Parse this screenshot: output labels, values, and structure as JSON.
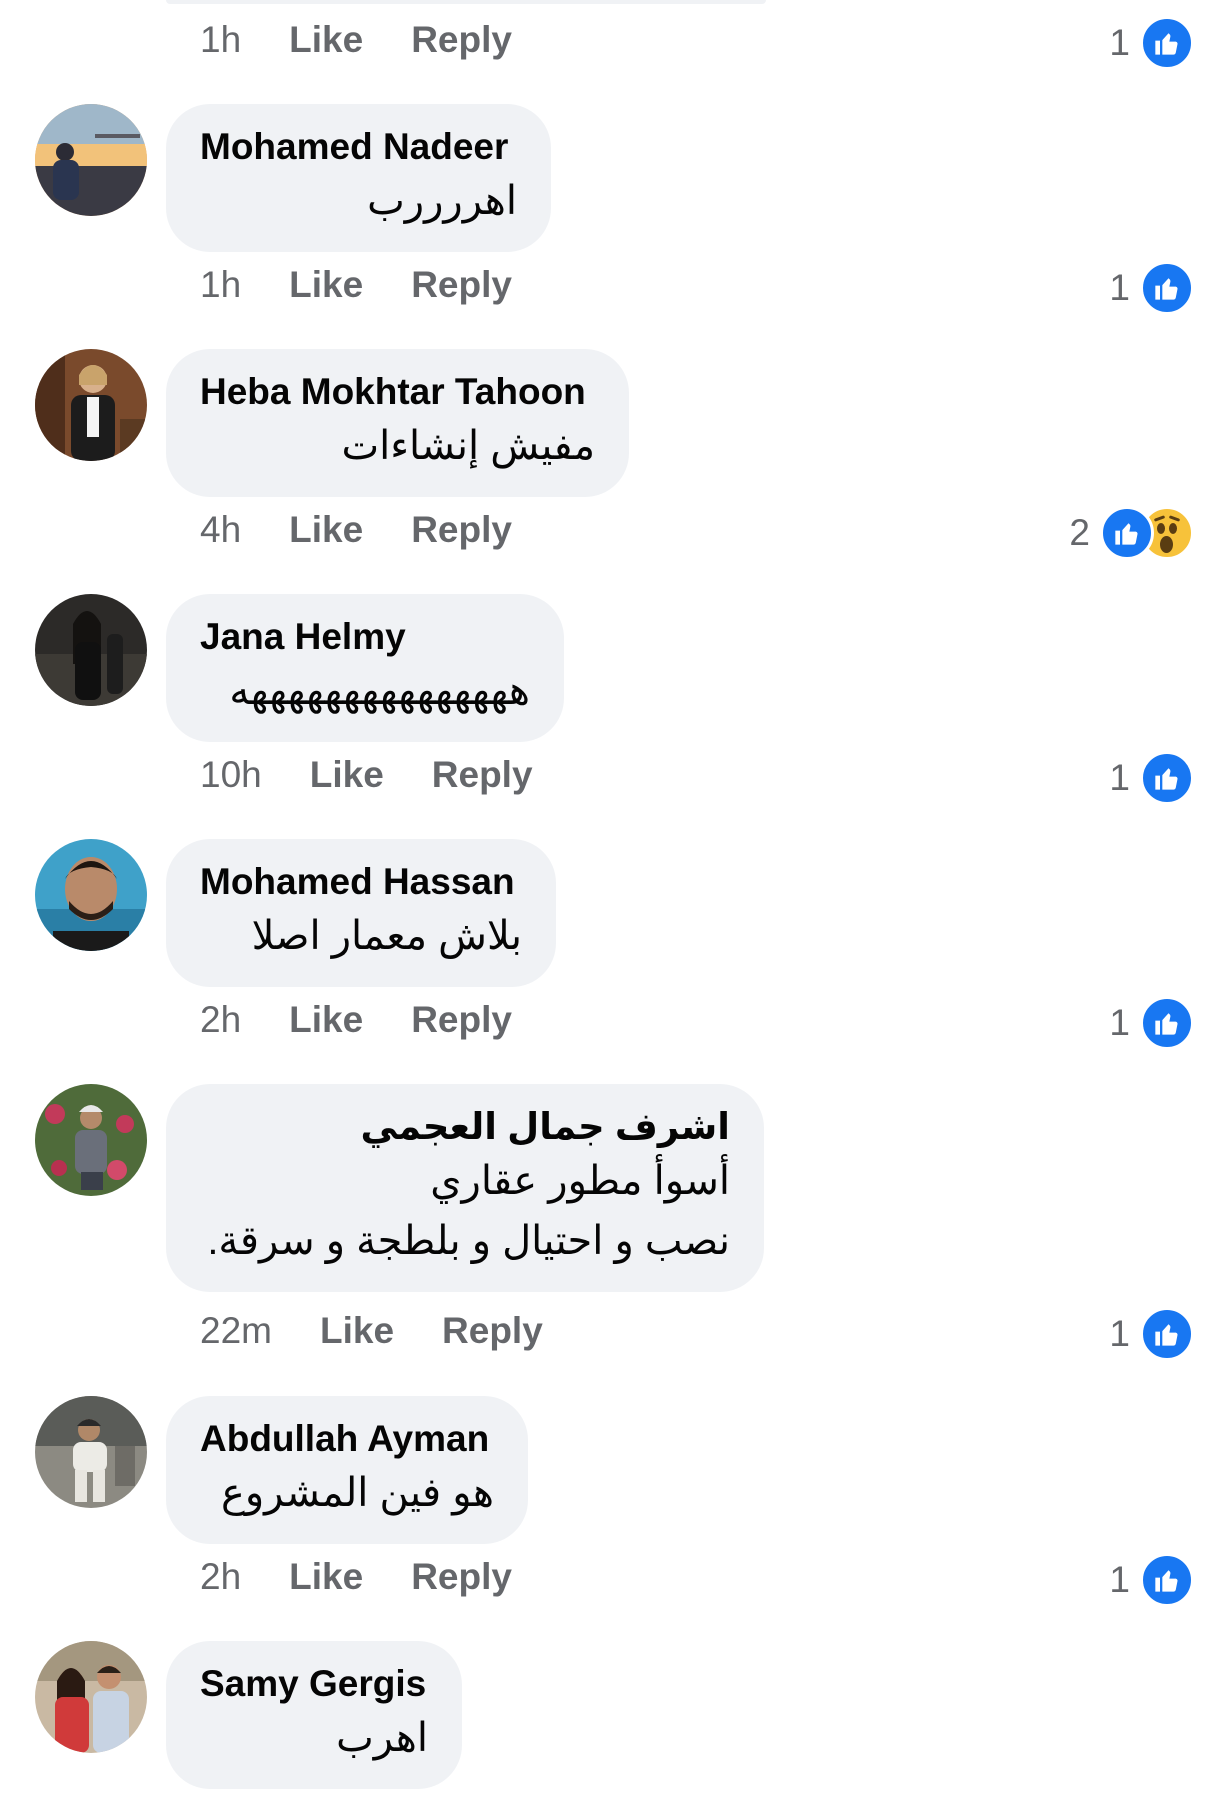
{
  "actions": {
    "like": "Like",
    "reply": "Reply"
  },
  "top_meta": {
    "time": "1h",
    "reactions": "1"
  },
  "comments": [
    {
      "name": "Mohamed Nadeer",
      "text": [
        "اهررررب"
      ],
      "time": "1h",
      "reactions": "1",
      "reaction_types": [
        "like"
      ]
    },
    {
      "name": "Heba Mokhtar Tahoon",
      "text": [
        "مفيش إنشاءات"
      ],
      "time": "4h",
      "reactions": "2",
      "reaction_types": [
        "like",
        "wow"
      ]
    },
    {
      "name": "Jana Helmy",
      "text": [
        "هههههههههههههههه"
      ],
      "time": "10h",
      "reactions": "1",
      "reaction_types": [
        "like"
      ]
    },
    {
      "name": "Mohamed Hassan",
      "text": [
        "بلاش معمار اصلا"
      ],
      "time": "2h",
      "reactions": "1",
      "reaction_types": [
        "like"
      ]
    },
    {
      "name": "اشرف جمال العجمي",
      "text": [
        "أسوأ مطور عقاري",
        "نصب و احتيال و بلطجة و سرقة."
      ],
      "time": "22m",
      "reactions": "1",
      "reaction_types": [
        "like"
      ]
    },
    {
      "name": "Abdullah Ayman",
      "text": [
        "هو فين المشروع"
      ],
      "time": "2h",
      "reactions": "1",
      "reaction_types": [
        "like"
      ]
    },
    {
      "name": "Samy Gergis",
      "text": [
        "اهرب"
      ]
    }
  ],
  "colors": {
    "bubble": "#f0f2f5",
    "meta_text": "#65676b",
    "like_blue": "#1877f2",
    "wow_yellow": "#f7c23a"
  }
}
